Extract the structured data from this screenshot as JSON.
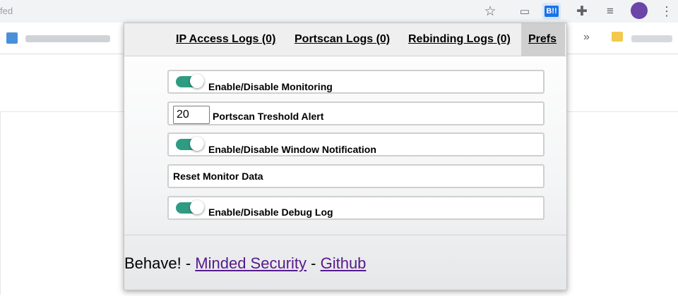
{
  "browser": {
    "omnibox_text": "fed",
    "extension_badge_label": "B!!",
    "icons": [
      "star-icon",
      "cast-icon",
      "extension-b-icon",
      "puzzle-icon",
      "media-queue-icon",
      "avatar",
      "more-vert-icon"
    ]
  },
  "popup": {
    "tabs": [
      {
        "label": "IP Access Logs (0)"
      },
      {
        "label": "Portscan Logs (0)"
      },
      {
        "label": "Rebinding Logs (0)"
      },
      {
        "label": "Prefs",
        "active": true
      }
    ],
    "prefs": {
      "monitoring": {
        "label": "Enable/Disable Monitoring",
        "enabled": true
      },
      "portscan_threshold": {
        "label": "Portscan Treshold Alert",
        "value": "20"
      },
      "window_notification": {
        "label": "Enable/Disable Window Notification",
        "enabled": true
      },
      "reset": {
        "label": "Reset Monitor Data"
      },
      "debug_log": {
        "label": "Enable/Disable Debug Log",
        "enabled": true
      }
    },
    "footer": {
      "prefix": "Behave! - ",
      "link1": "Minded Security",
      "separator": " - ",
      "link2": "Github"
    },
    "colors": {
      "toggle_on": "#2e9c82",
      "active_tab": "#cfcfcf",
      "visited_link": "#551a8b"
    }
  }
}
